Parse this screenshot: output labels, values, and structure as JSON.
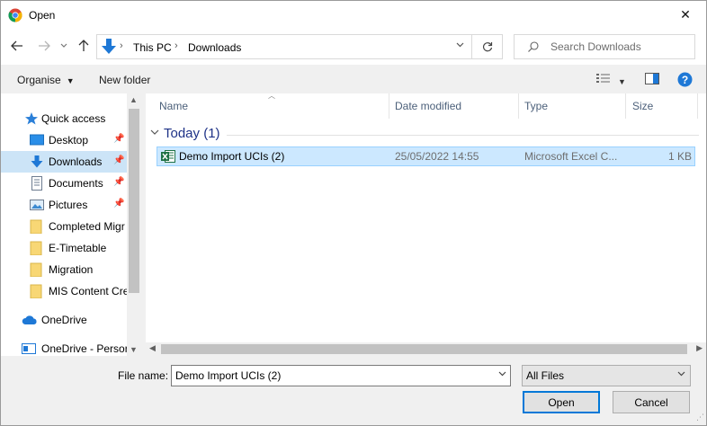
{
  "window": {
    "title": "Open",
    "close_glyph": "✕"
  },
  "nav": {
    "back_icon": "arrow-left-icon",
    "forward_icon": "arrow-right-icon",
    "recent_icon": "chevron-down-icon",
    "up_icon": "arrow-up-icon",
    "breadcrumbs": [
      "This PC",
      "Downloads"
    ],
    "search_placeholder": "Search Downloads"
  },
  "toolbar": {
    "organise": "Organise",
    "new_folder": "New folder"
  },
  "sidebar": {
    "items": [
      {
        "label": "Quick access",
        "icon": "star-icon"
      },
      {
        "label": "Desktop",
        "icon": "desktop-icon",
        "pinned": true
      },
      {
        "label": "Downloads",
        "icon": "download-icon",
        "pinned": true,
        "selected": true
      },
      {
        "label": "Documents",
        "icon": "document-icon",
        "pinned": true
      },
      {
        "label": "Pictures",
        "icon": "pictures-icon",
        "pinned": true
      },
      {
        "label": "Completed Migr",
        "icon": "folder-icon"
      },
      {
        "label": "E-Timetable",
        "icon": "folder-icon"
      },
      {
        "label": "Migration",
        "icon": "folder-icon"
      },
      {
        "label": "MIS Content Cre",
        "icon": "folder-icon"
      },
      {
        "label": "OneDrive",
        "icon": "cloud-icon"
      },
      {
        "label": "OneDrive - Persor",
        "icon": "onedrive-business-icon"
      }
    ]
  },
  "columns": [
    "Name",
    "Date modified",
    "Type",
    "Size"
  ],
  "group": {
    "title": "Today (1)"
  },
  "files": [
    {
      "name": "Demo Import UCIs (2)",
      "date": "25/05/2022 14:55",
      "type": "Microsoft Excel C...",
      "size": "1 KB",
      "icon": "excel-icon"
    }
  ],
  "footer": {
    "file_name_label": "File name:",
    "file_name_value": "Demo Import UCIs (2)",
    "filter_value": "All Files",
    "open_label": "Open",
    "cancel_label": "Cancel"
  },
  "colors": {
    "selection": "#cce8ff",
    "accent": "#0078d7",
    "group_title": "#1e3287"
  }
}
